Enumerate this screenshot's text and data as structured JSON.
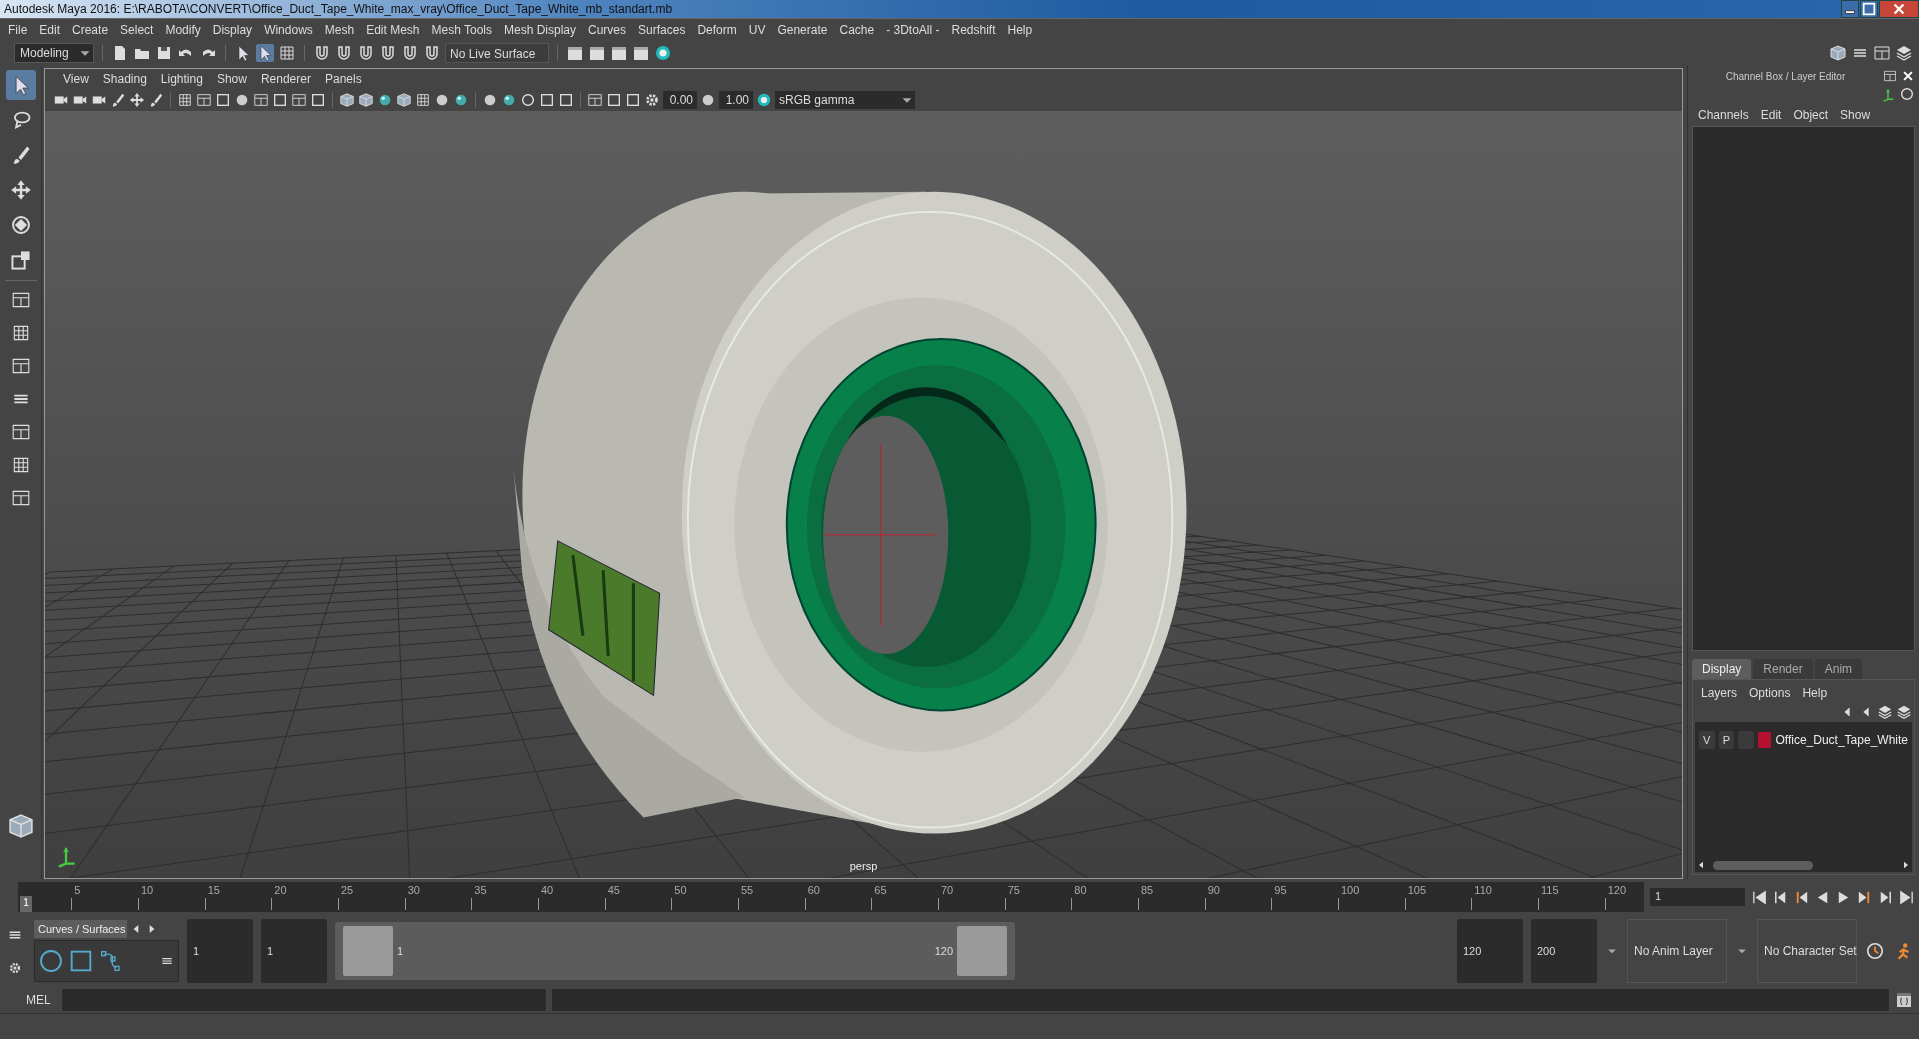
{
  "window": {
    "title": "Autodesk Maya 2016: E:\\RABOTA\\CONVERT\\Office_Duct_Tape_White_max_vray\\Office_Duct_Tape_White_mb_standart.mb"
  },
  "menu_bar": [
    "File",
    "Edit",
    "Create",
    "Select",
    "Modify",
    "Display",
    "Windows",
    "Mesh",
    "Edit Mesh",
    "Mesh Tools",
    "Mesh Display",
    "Curves",
    "Surfaces",
    "Deform",
    "UV",
    "Generate",
    "Cache",
    "- 3DtoAll -",
    "Redshift",
    "Help"
  ],
  "status_line": {
    "workspace": "Modeling",
    "live_surface": "No Live Surface"
  },
  "toolbox": {
    "tools": [
      {
        "kind": "select",
        "selected": true
      },
      {
        "kind": "lasso",
        "selected": false
      },
      {
        "kind": "paint",
        "selected": false
      },
      {
        "kind": "move",
        "selected": false
      },
      {
        "kind": "rotate",
        "selected": false
      },
      {
        "kind": "scale",
        "selected": false
      }
    ]
  },
  "viewport": {
    "menus": [
      "View",
      "Shading",
      "Lighting",
      "Show",
      "Renderer",
      "Panels"
    ],
    "exposure": "0.00",
    "gamma": "1.00",
    "color_space": "sRGB gamma",
    "camera_label": "persp"
  },
  "channel_box": {
    "title": "Channel Box / Layer Editor",
    "menus": [
      "Channels",
      "Edit",
      "Object",
      "Show"
    ]
  },
  "layer_editor": {
    "tabs": [
      {
        "label": "Display",
        "selected": true
      },
      {
        "label": "Render",
        "selected": false
      },
      {
        "label": "Anim",
        "selected": false
      }
    ],
    "menus": [
      "Layers",
      "Options",
      "Help"
    ],
    "layers": [
      {
        "v_toggle": "V",
        "p_toggle": "P",
        "color": "#b5112f",
        "name": "Office_Duct_Tape_White"
      }
    ]
  },
  "timeline": {
    "start_label": "1",
    "tick_labels": [
      "5",
      "10",
      "15",
      "20",
      "25",
      "30",
      "35",
      "40",
      "45",
      "50",
      "55",
      "60",
      "65",
      "70",
      "75",
      "80",
      "85",
      "90",
      "95",
      "100",
      "105",
      "110",
      "115",
      "120"
    ],
    "current_frame": "1",
    "level": 0
  },
  "range": {
    "shelf_tab": "Curves / Surfaces",
    "start_time": "1",
    "playback_start": "1",
    "slider_start": "1",
    "slider_end": "120",
    "start_handle": {
      "level": 0
    },
    "end_handle": {
      "level": 1
    },
    "playback_end": "120",
    "end_time": "200",
    "anim_layer": "No Anim Layer",
    "character_set": "No Character Set"
  },
  "command_line": {
    "language": "MEL"
  }
}
